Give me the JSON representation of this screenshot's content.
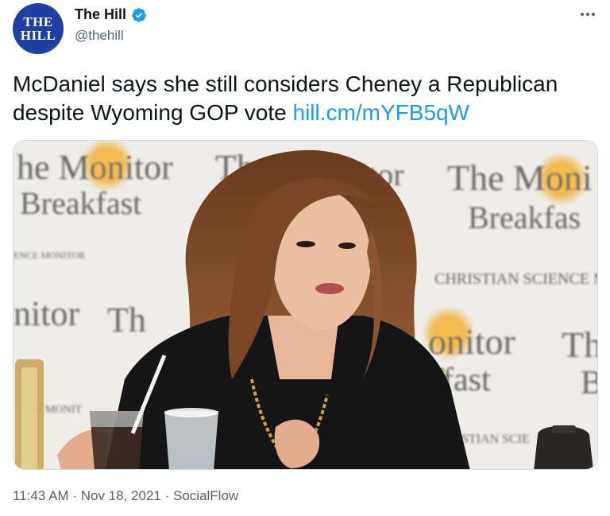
{
  "author": {
    "name": "The Hill",
    "handle": "@thehill",
    "avatar_text_line1": "THE",
    "avatar_text_line2": "HILL",
    "verified": true
  },
  "tweet": {
    "text": "McDaniel says she still considers Cheney a Republican despite Wyoming GOP vote ",
    "link": "hill.cm/mYFB5qW"
  },
  "media": {
    "backdrop_text": {
      "monitor_1": "he Monitor",
      "breakfast_1": "Breakfast",
      "the_1": "Th",
      "itor_1": "itor",
      "the_moni": "The Moni",
      "breakfas": "Breakfas",
      "science_monitor": "ENCE MONITOR",
      "christian_science": "CHRISTIAN SCIENCE M",
      "nitor_2": "nitor",
      "th_2": "Th",
      "onitor_3": "onitor",
      "th_3": "Th",
      "fast_3": "fast",
      "b_3": "B",
      "ristian_scie": "RISTIAN SCIE",
      "monit_4": "E MONIT"
    }
  },
  "footer": {
    "time": "11:43 AM",
    "separator": "·",
    "date": "Nov 18, 2021",
    "source": "SocialFlow"
  },
  "colors": {
    "brand_blue": "#1f3fa3",
    "link_blue": "#1d9bf0",
    "secondary_text": "#536471",
    "sun_orange": "#f3b23a"
  },
  "icons": [
    "verified-badge-icon",
    "more-options-icon"
  ]
}
